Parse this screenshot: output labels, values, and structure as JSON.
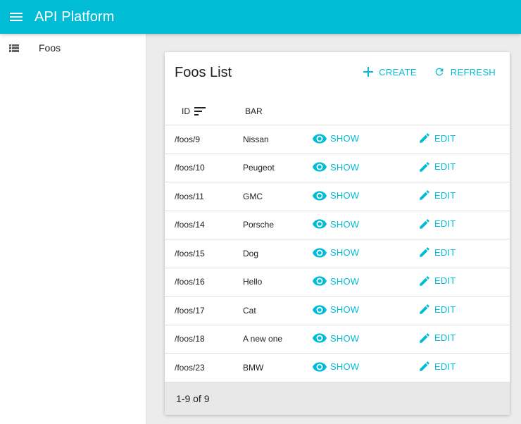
{
  "app": {
    "title": "API Platform"
  },
  "sidebar": {
    "items": [
      {
        "label": "Foos",
        "icon": "list-icon"
      }
    ]
  },
  "list": {
    "title": "Foos List",
    "actions": {
      "create": "CREATE",
      "refresh": "REFRESH"
    },
    "columns": {
      "id": "ID",
      "bar": "BAR"
    },
    "sort": {
      "column": "ID",
      "icon": "sort-icon"
    },
    "row_actions": {
      "show": "SHOW",
      "edit": "EDIT"
    },
    "rows": [
      {
        "id": "/foos/9",
        "bar": "Nissan"
      },
      {
        "id": "/foos/10",
        "bar": "Peugeot"
      },
      {
        "id": "/foos/11",
        "bar": "GMC"
      },
      {
        "id": "/foos/14",
        "bar": "Porsche"
      },
      {
        "id": "/foos/15",
        "bar": "Dog"
      },
      {
        "id": "/foos/16",
        "bar": "Hello"
      },
      {
        "id": "/foos/17",
        "bar": "Cat"
      },
      {
        "id": "/foos/18",
        "bar": "A new one"
      },
      {
        "id": "/foos/23",
        "bar": "BMW"
      }
    ],
    "pagination": "1-9 of 9"
  },
  "colors": {
    "primary": "#00bcd4",
    "background": "#edecec",
    "footer": "#e8e8e8"
  }
}
